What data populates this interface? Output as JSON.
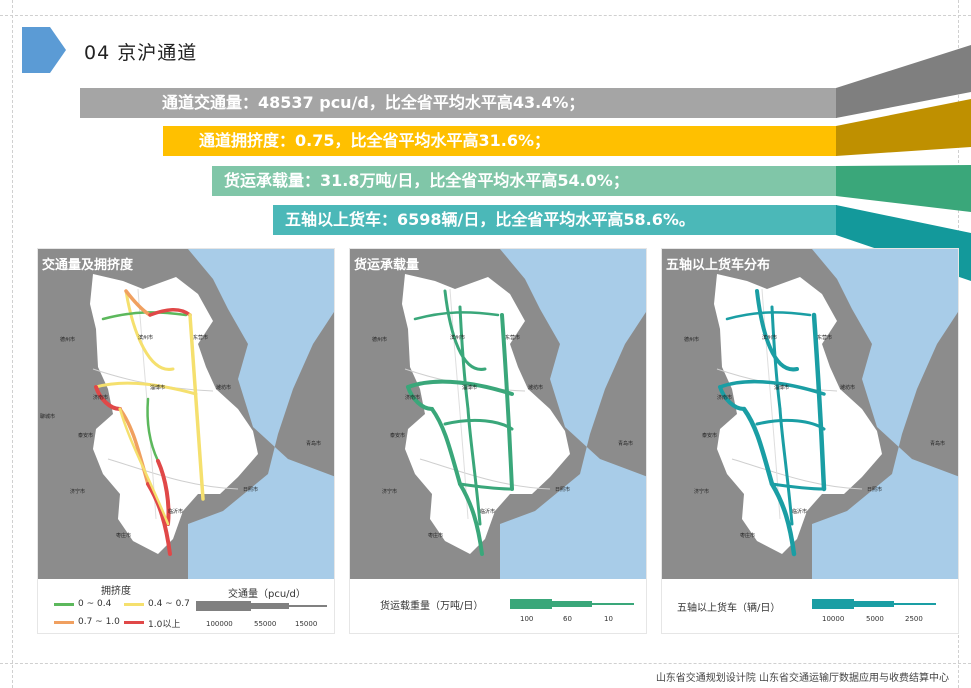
{
  "header": {
    "title": "04  京沪通道",
    "accent_color": "#5b9bd5"
  },
  "stats": [
    {
      "text": "通道交通量：48537 pcu/d，比全省平均水平高43.4%；",
      "color": "#a5a5a5"
    },
    {
      "text": "通道拥挤度：0.75，比全省平均水平高31.6%；",
      "color": "#ffc000"
    },
    {
      "text": "货运承载量：31.8万吨/日，比全省平均水平高54.0%；",
      "color": "#80c6a8"
    },
    {
      "text": "五轴以上货车：6598辆/日，比全省平均水平高58.6%。",
      "color": "#4bb8b8"
    }
  ],
  "panels": [
    {
      "label": "交通量及拥挤度",
      "legend": {
        "congestion_title": "拥挤度",
        "classes": [
          {
            "label": "0 ~ 0.4",
            "color": "#5cb85c"
          },
          {
            "label": "0.4 ~ 0.7",
            "color": "#f5e06e"
          },
          {
            "label": "0.7 ~ 1.0",
            "color": "#f0a060"
          },
          {
            "label": "1.0以上",
            "color": "#e04848"
          }
        ],
        "volume_title": "交通量（pcu/d）",
        "volume_ticks": [
          "100000",
          "55000",
          "15000"
        ]
      }
    },
    {
      "label": "货运承载量",
      "legend": {
        "title": "货运载重量（万吨/日）",
        "ticks": [
          "100",
          "60",
          "10"
        ],
        "color": "#3aa77a"
      }
    },
    {
      "label": "五轴以上货车分布",
      "legend": {
        "title": "五轴以上货车（辆/日）",
        "ticks": [
          "10000",
          "5000",
          "2500"
        ],
        "color": "#1a9ea4"
      }
    }
  ],
  "map_labels": [
    "德州市",
    "滨州市",
    "东营市",
    "淄博市",
    "潍坊市",
    "济南市",
    "泰安市",
    "济宁市",
    "临沂市",
    "日照市",
    "青岛市",
    "枣庄市",
    "聊城市"
  ],
  "footer": "山东省交通规划设计院   山东省交通运输厅数据应用与收费结算中心"
}
